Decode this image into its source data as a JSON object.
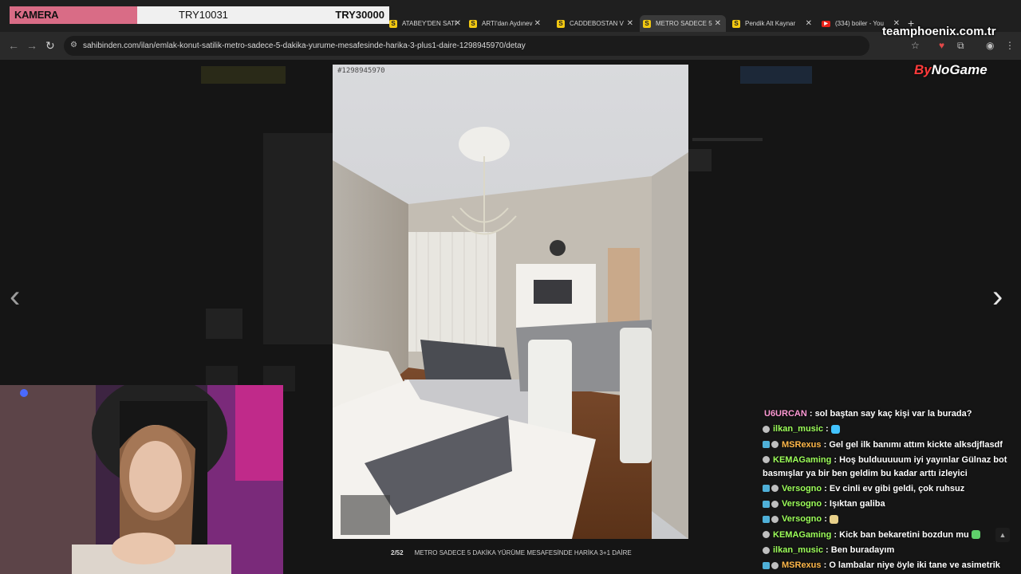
{
  "overlay": {
    "camera_label": "KAMERA",
    "price_1": "TRY10031",
    "price_2": "TRY30000"
  },
  "tabs": [
    {
      "label": "ATABEY'DEN SATI",
      "fav": "S"
    },
    {
      "label": "ARTI'dan Aydınev",
      "fav": "S"
    },
    {
      "label": "CADDEBOSTAN V",
      "fav": "S"
    },
    {
      "label": "METRO SADECE 5",
      "fav": "S",
      "active": true
    },
    {
      "label": "Pendik Alt Kaynar",
      "fav": "S"
    },
    {
      "label": "(334) boiler - You",
      "fav": "▶"
    }
  ],
  "address": {
    "url": "sahibinden.com/ilan/emlak-konut-satilik-metro-sadece-5-dakika-yurume-mesafesinde-harika-3-plus1-daire-1298945970/detay"
  },
  "gallery": {
    "listing_id": "#1298945970",
    "counter": "2/52",
    "caption": "METRO SADECE 5 DAKİKA YÜRÜME MESAFESİNDE HARİKA 3+1 DAİRE",
    "prev_icon": "chevron-left-icon",
    "next_icon": "chevron-right-icon"
  },
  "watermarks": {
    "site": "teamphoenix.com.tr",
    "brand_prefix": "By",
    "brand": "NoGame"
  },
  "chat": [
    {
      "user": "U6URCAN",
      "color": "#ff9ad5",
      "text": "sol baştan say kaç kişi var la burada?",
      "badges": 0
    },
    {
      "user": "ilkan_music",
      "color": "#9dff5a",
      "text": ":",
      "badges": 1,
      "emoji": "#42c3ff"
    },
    {
      "user": "MSRexus",
      "color": "#ffb84a",
      "text": "Gel gel ilk banımı attım kickte alksdjflasdf",
      "badges": 2
    },
    {
      "user": "KEMAGaming",
      "color": "#9dff5a",
      "text": "Hoş bulduuuuum iyi yayınlar Gülnaz bot basmışlar ya bir ben geldim bu kadar arttı izleyici",
      "badges": 1,
      "wrap": true
    },
    {
      "user": "Versogno",
      "color": "#9dff5a",
      "text": "Ev cinli ev gibi geldi, çok ruhsuz",
      "badges": 2
    },
    {
      "user": "Versogno",
      "color": "#9dff5a",
      "text": "Işıktan galiba",
      "badges": 2
    },
    {
      "user": "Versogno",
      "color": "#9dff5a",
      "text": ":",
      "badges": 2,
      "emoji": "#e8d08a"
    },
    {
      "user": "KEMAGaming",
      "color": "#9dff5a",
      "text": "Kick ban bekaretini bozdun mu",
      "badges": 1,
      "emoji": "#5fd16b"
    },
    {
      "user": "ilkan_music",
      "color": "#9dff5a",
      "text": "Ben buradayım",
      "badges": 1
    },
    {
      "user": "MSRexus",
      "color": "#ffb84a",
      "text": "O lambalar niye öyle iki tane ve asimetrik",
      "badges": 2
    }
  ]
}
